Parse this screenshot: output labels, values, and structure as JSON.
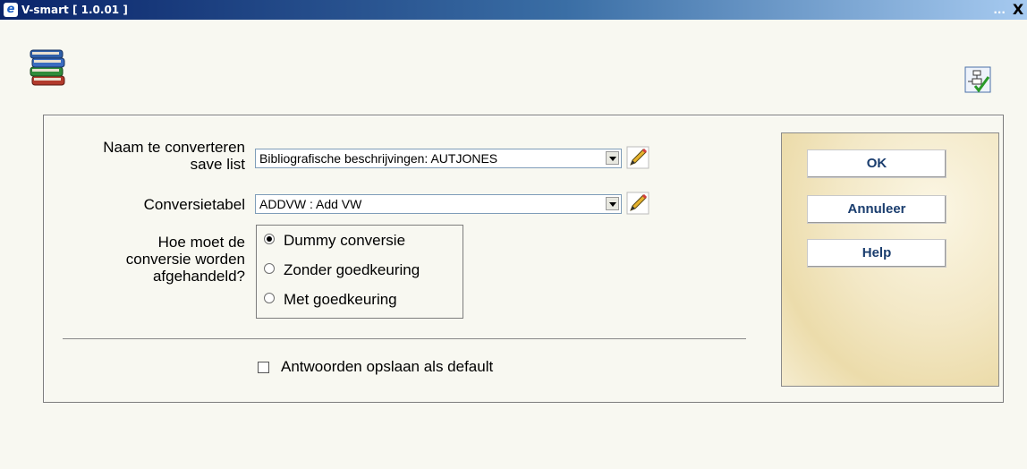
{
  "window": {
    "title": "V-smart [ 1.0.01 ]",
    "minimize_label": "...",
    "close_label": "X"
  },
  "form": {
    "savelist_label_line1": "Naam te converteren",
    "savelist_label_line2": "save list",
    "savelist_value": "Bibliografische beschrijvingen: AUTJONES",
    "conversion_label": "Conversietabel",
    "conversion_value": "ADDVW : Add VW",
    "handling_label_line1": "Hoe moet de",
    "handling_label_line2": "conversie worden",
    "handling_label_line3": "afgehandeld?",
    "radio_options": [
      "Dummy conversie",
      "Zonder goedkeuring",
      "Met goedkeuring"
    ],
    "radio_selected_index": 0,
    "save_default_label": "Antwoorden opslaan als default",
    "save_default_checked": false
  },
  "buttons": {
    "ok": "OK",
    "cancel": "Annuleer",
    "help": "Help"
  },
  "icons": {
    "app": "ie-icon",
    "books": "books-icon",
    "tool": "flowchart-check-icon",
    "edit": "pencil-icon"
  }
}
